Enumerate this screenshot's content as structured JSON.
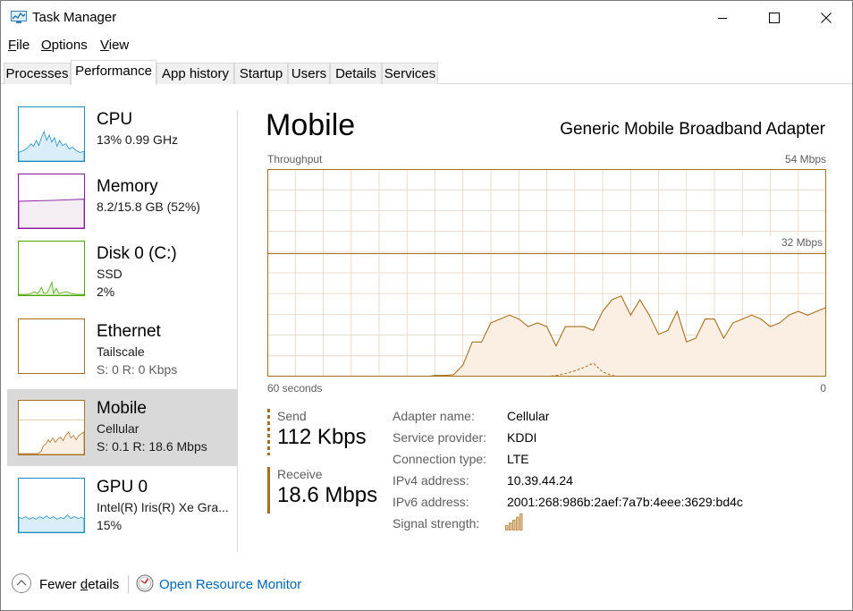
{
  "window": {
    "title": "Task Manager"
  },
  "menu": {
    "file_pre": "",
    "file_u": "F",
    "file_post": "ile",
    "options_u": "O",
    "options_post": "ptions",
    "view_u": "V",
    "view_post": "iew"
  },
  "tabs": [
    "Processes",
    "Performance",
    "App history",
    "Startup",
    "Users",
    "Details",
    "Services"
  ],
  "sidebar": {
    "items": [
      {
        "title": "CPU",
        "line1": "13%  0.99 GHz",
        "line2": "",
        "color": "#1b8dbf"
      },
      {
        "title": "Memory",
        "line1": "8.2/15.8 GB (52%)",
        "line2": "",
        "color": "#8b1aa0"
      },
      {
        "title": "Disk 0 (C:)",
        "line1": "SSD",
        "line2": "2%",
        "color": "#4da60c"
      },
      {
        "title": "Ethernet",
        "line1": "Tailscale",
        "line2": "S: 0 R: 0 Kbps",
        "color": "#a7701f"
      },
      {
        "title": "Mobile",
        "line1": "Cellular",
        "line2": "S: 0.1  R: 18.6 Mbps",
        "color": "#a7701f"
      },
      {
        "title": "GPU 0",
        "line1": "Intel(R) Iris(R) Xe Gra...",
        "line2": "15%",
        "color": "#1b8dbf"
      }
    ]
  },
  "main": {
    "title": "Mobile",
    "adapter": "Generic Mobile Broadband Adapter",
    "chart_top_left": "Throughput",
    "chart_top_right": "54 Mbps",
    "chart_mid_label": "32 Mbps",
    "chart_bottom_left": "60 seconds",
    "chart_bottom_right": "0",
    "send_label": "Send",
    "send_value": "112 Kbps",
    "receive_label": "Receive",
    "receive_value": "18.6 Mbps",
    "properties": [
      {
        "label": "Adapter name:",
        "value": "Cellular"
      },
      {
        "label": "Service provider:",
        "value": "KDDI"
      },
      {
        "label": "Connection type:",
        "value": "LTE"
      },
      {
        "label": "IPv4 address:",
        "value": "10.39.44.24"
      },
      {
        "label": "IPv6 address:",
        "value": "2001:268:986b:2aef:7a7b:4eee:3629:bd4c"
      },
      {
        "label": "Signal strength:",
        "value": ""
      }
    ]
  },
  "footer": {
    "fewer_pre": "Fewer ",
    "fewer_u": "d",
    "fewer_post": "etails",
    "open_monitor": "Open Resource Monitor"
  },
  "colors": {
    "accent": "#a7701f",
    "fill": "#fbeee2",
    "grid": "#e6d4bf"
  },
  "chart_data": {
    "type": "area",
    "title": "Throughput",
    "xlabel": "60 seconds",
    "x_range": [
      60,
      0
    ],
    "ylim": [
      0,
      54
    ],
    "unit": "Mbps",
    "reference_line": 32,
    "series": [
      {
        "name": "Receive",
        "x": [
          60,
          59,
          58,
          57,
          56,
          55,
          54,
          53,
          52,
          51,
          50,
          49,
          48,
          47,
          46,
          45,
          44,
          43,
          42,
          41,
          40,
          39,
          38,
          37,
          36,
          35,
          34,
          33,
          32,
          31,
          30,
          29,
          28,
          27,
          26,
          25,
          24,
          23,
          22,
          21,
          20,
          19,
          18,
          17,
          16,
          15,
          14,
          13,
          12,
          11,
          10,
          9,
          8,
          7,
          6,
          5,
          4,
          3,
          2,
          1,
          0
        ],
        "values": [
          0,
          0,
          0,
          0,
          0,
          0,
          0,
          0,
          0,
          0,
          0,
          0,
          0,
          0,
          0,
          0,
          0,
          0,
          0.3,
          0.3,
          0.5,
          3,
          9,
          9,
          14,
          15,
          16,
          15,
          13,
          14,
          13,
          8,
          13,
          13,
          13,
          12,
          17,
          20,
          21,
          16,
          20,
          16,
          11,
          12,
          17,
          9,
          10,
          15,
          15,
          10,
          14,
          15,
          16,
          15,
          13,
          14,
          16,
          17,
          16,
          17,
          18
        ],
        "style": "solid"
      },
      {
        "name": "Send",
        "x": [
          30,
          29,
          28,
          27,
          26,
          25,
          24,
          23,
          22
        ],
        "values": [
          0,
          0.3,
          0.8,
          1.5,
          2.4,
          3.5,
          1.2,
          0.3,
          0
        ],
        "style": "dashed"
      }
    ]
  }
}
